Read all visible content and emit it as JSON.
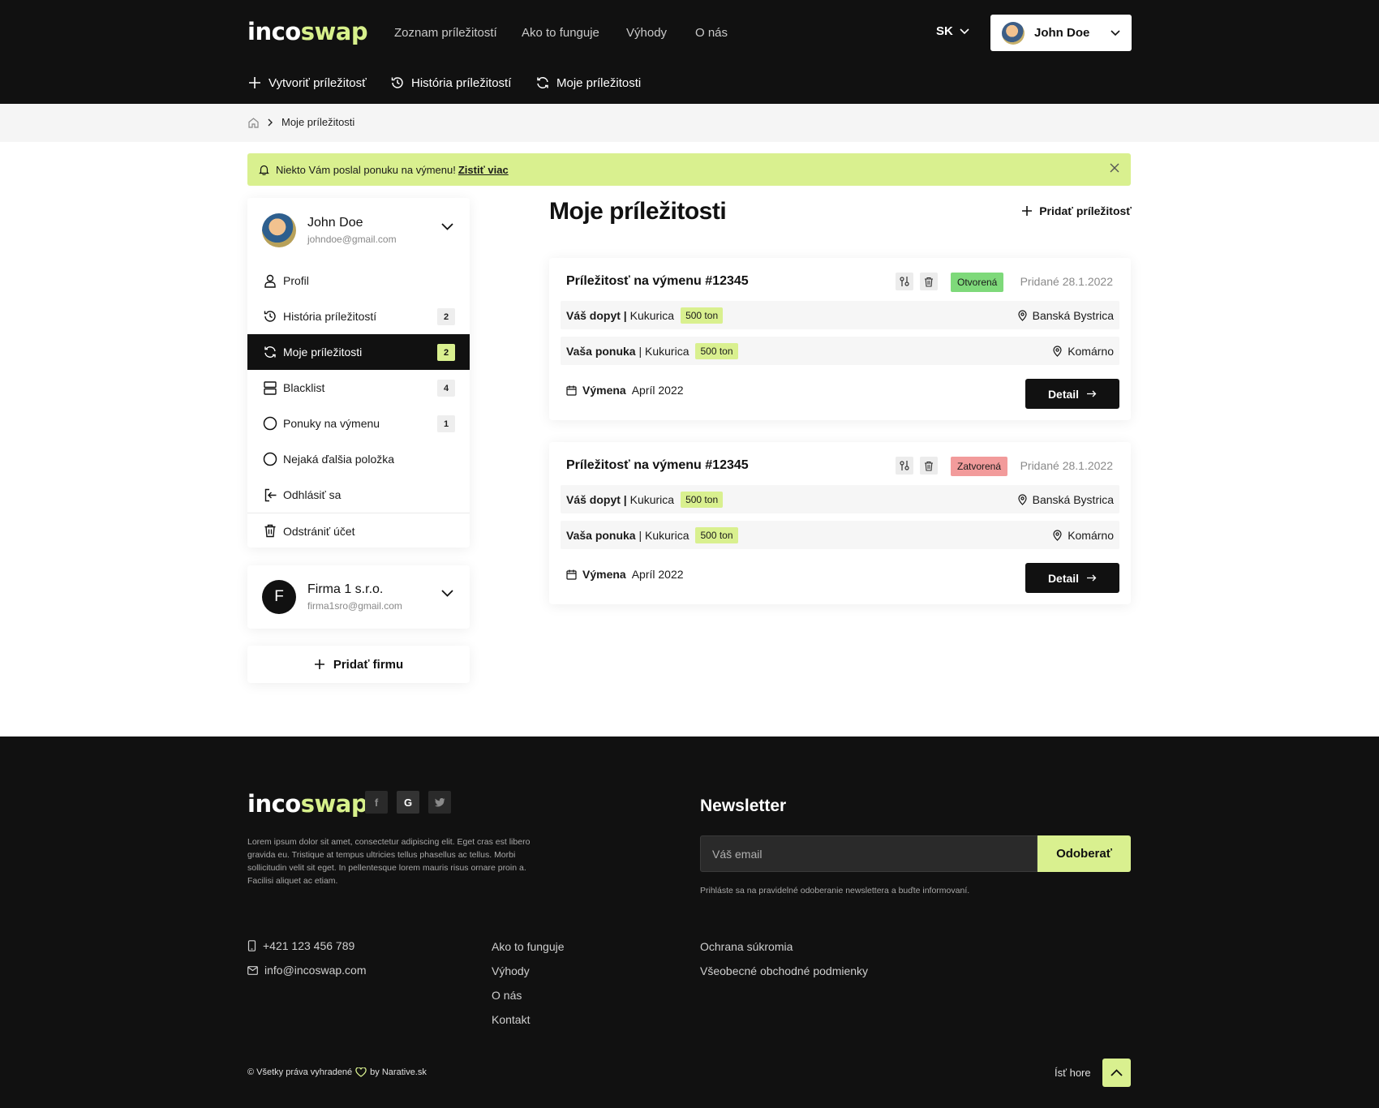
{
  "brand": {
    "logo_white": "inco",
    "logo_green": "swap",
    "accent": "#d9f08f",
    "dark": "#111111"
  },
  "nav": {
    "links": [
      "Zoznam príležitostí",
      "Ako to funguje",
      "Výhody",
      "O nás"
    ],
    "lang": "SK",
    "user_name": "John Doe",
    "subnav": [
      "Vytvoriť príležitosť",
      "História príležitostí",
      "Moje príležitosti"
    ]
  },
  "breadcrumb": {
    "current": "Moje príležitosti"
  },
  "alert": {
    "text": "Niekto Vám poslal ponuku na výmenu!",
    "link": "Zistiť viac"
  },
  "sidebar": {
    "user": {
      "name": "John Doe",
      "email": "johndoe@gmail.com"
    },
    "items": [
      {
        "label": "Profil",
        "icon": "user-icon"
      },
      {
        "label": "História príležitostí",
        "icon": "history-icon",
        "badge": "2"
      },
      {
        "label": "Moje príležitosti",
        "icon": "refresh-icon",
        "badge": "2",
        "active": true
      },
      {
        "label": "Blacklist",
        "icon": "server-icon",
        "badge": "4"
      },
      {
        "label": "Ponuky na výmenu",
        "icon": "circle-icon",
        "badge": "1"
      },
      {
        "label": "Nejaká ďalšia položka",
        "icon": "circle-icon"
      },
      {
        "label": "Odhlásiť sa",
        "icon": "logout-icon"
      },
      {
        "label": "Odstrániť účet",
        "icon": "trash-icon"
      }
    ],
    "firm": {
      "initial": "F",
      "name": "Firma 1 s.r.o.",
      "email": "firma1sro@gmail.com"
    },
    "add_firm": "Pridať firmu"
  },
  "main": {
    "title": "Moje príležitosti",
    "add_label": "Pridať príležitosť",
    "opportunities": [
      {
        "title": "Príležitosť na výmenu #12345",
        "status": "Otvorená",
        "added": "Pridané 28.1.2022",
        "demand_label": "Váš dopyt |",
        "demand_item": "Kukurica",
        "demand_qty": "500 ton",
        "demand_loc": "Banská Bystrica",
        "offer_label": "Vaša ponuka",
        "offer_item": "| Kukurica",
        "offer_qty": "500 ton",
        "offer_loc": "Komárno",
        "exchange_label": "Výmena",
        "exchange_date": "Apríl 2022",
        "detail": "Detail"
      },
      {
        "title": "Príležitosť na výmenu #12345",
        "status": "Zatvorená",
        "added": "Pridané 28.1.2022",
        "demand_label": "Váš dopyt |",
        "demand_item": "Kukurica",
        "demand_qty": "500 ton",
        "demand_loc": "Banská Bystrica",
        "offer_label": "Vaša ponuka",
        "offer_item": "| Kukurica",
        "offer_qty": "500 ton",
        "offer_loc": "Komárno",
        "exchange_label": "Výmena",
        "exchange_date": "Apríl 2022",
        "detail": "Detail"
      }
    ]
  },
  "footer": {
    "social": [
      "f",
      "G",
      "t"
    ],
    "description": "Lorem ipsum dolor sit amet, consectetur adipiscing elit. Eget cras est libero gravida eu. Tristique at tempus ultricies tellus phasellus ac tellus. Morbi sollicitudin velit sit eget. In pellentesque lorem mauris risus ornare proin a. Facilisi aliquet ac etiam.",
    "newsletter_title": "Newsletter",
    "email_placeholder": "Váš email",
    "subscribe": "Odoberať",
    "newsletter_note": "Prihláste sa na pravidelné odoberanie newslettera a buďte informovaní.",
    "phone": "+421 123 456 789",
    "email": "info@incoswap.com",
    "links_col1": [
      "Ako to funguje",
      "Výhody",
      "O nás",
      "Kontakt"
    ],
    "links_col2": [
      "Ochrana súkromia",
      "Všeobecné obchodné podmienky"
    ],
    "copyright_left": "© Všetky práva vyhradené",
    "copyright_right": "by Narative.sk",
    "back_to_top": "Ísť hore"
  }
}
